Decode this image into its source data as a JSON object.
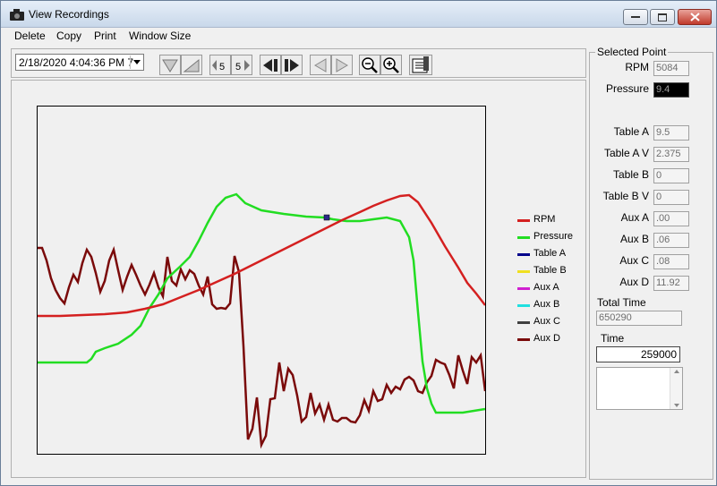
{
  "window": {
    "title": "View Recordings"
  },
  "menu": [
    "Delete",
    "Copy",
    "Print",
    "Window Size"
  ],
  "toolbar": {
    "date_value": "2/18/2020 4:04:36 PM 7",
    "buttons": [
      "scale-down-icon",
      "scale-up-icon",
      "step-5-back-icon",
      "step-5-forward-icon",
      "jump-start-icon",
      "jump-end-icon",
      "prev-icon",
      "next-icon",
      "zoom-out-icon",
      "zoom-in-icon",
      "notes-icon"
    ],
    "step_label": "5"
  },
  "legend": [
    {
      "name": "RPM",
      "color": "#d42020"
    },
    {
      "name": "Pressure",
      "color": "#22dd22"
    },
    {
      "name": "Table A",
      "color": "#00008b"
    },
    {
      "name": "Table B",
      "color": "#f0e020"
    },
    {
      "name": "Aux A",
      "color": "#d020d0"
    },
    {
      "name": "Aux B",
      "color": "#20e0e0"
    },
    {
      "name": "Aux C",
      "color": "#404040"
    },
    {
      "name": "Aux D",
      "color": "#7a0a0a"
    }
  ],
  "selected_point": {
    "group_title": "Selected Point",
    "rpm_label": "RPM",
    "rpm": "5084",
    "pressure_label": "Pressure",
    "pressure": "9.4",
    "table_a_label": "Table A",
    "table_a": "9.5",
    "table_av_label": "Table A V",
    "table_av": "2.375",
    "table_b_label": "Table B",
    "table_b": "0",
    "table_bv_label": "Table B V",
    "table_bv": "0",
    "aux_a_label": "Aux A",
    "aux_a": ".00",
    "aux_b_label": "Aux B",
    "aux_b": ".06",
    "aux_c_label": "Aux C",
    "aux_c": ".08",
    "aux_d_label": "Aux D",
    "aux_d": "11.92",
    "total_time_label": "Total Time",
    "total_time": "650290",
    "time_label": "Time",
    "time": "259000"
  }
}
